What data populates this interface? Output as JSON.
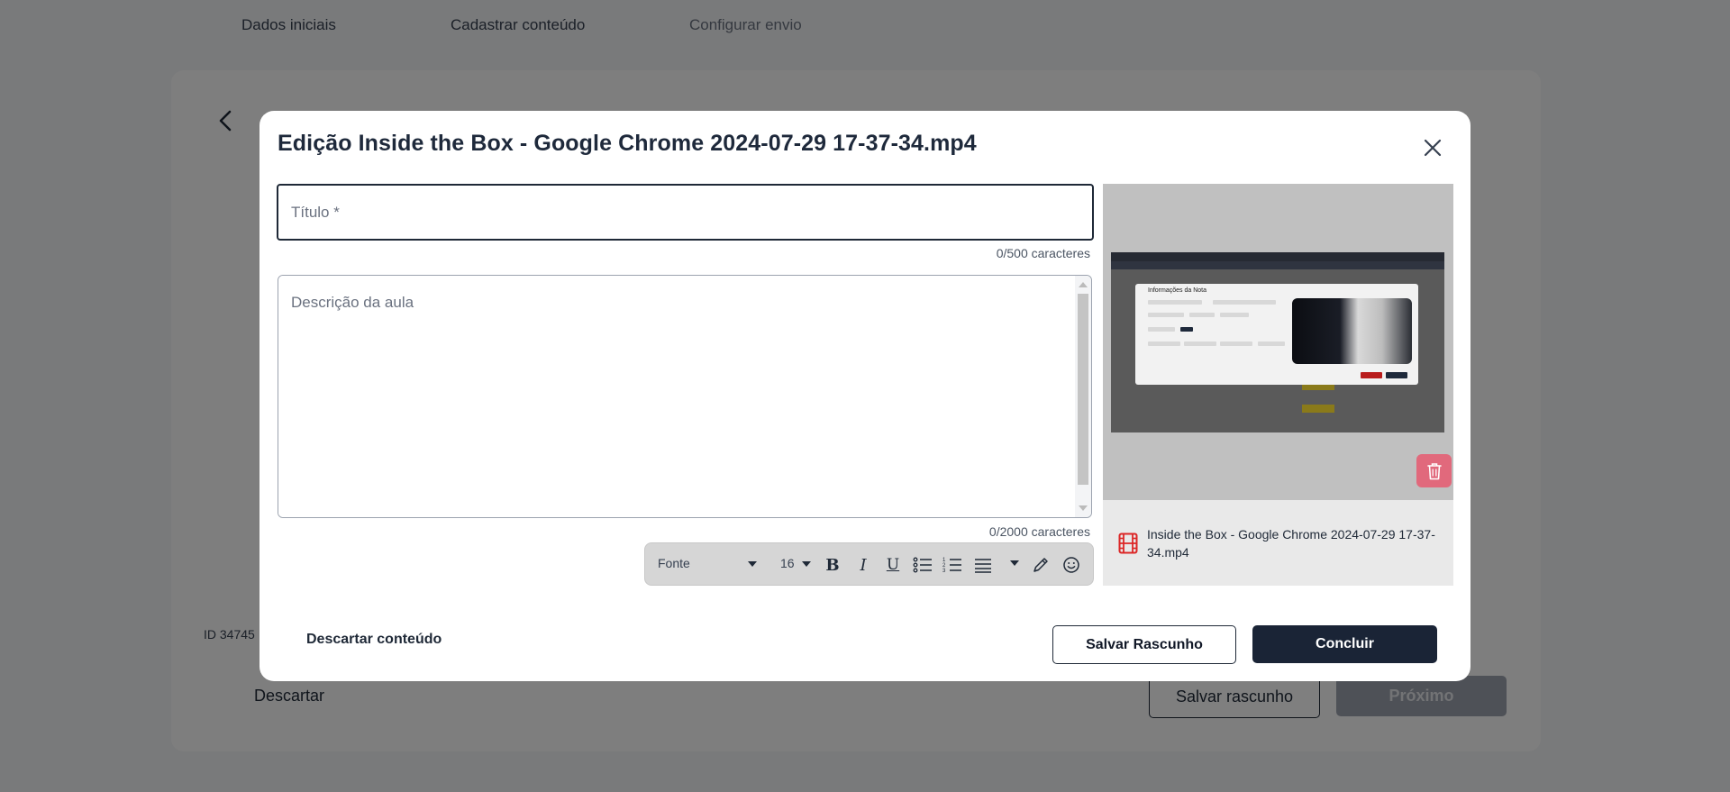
{
  "background": {
    "steps": [
      "Dados iniciais",
      "Cadastrar conteúdo",
      "Configurar envio"
    ],
    "id_text": "ID 34745 |",
    "discard_label": "Descartar",
    "save_label": "Salvar rascunho",
    "next_label": "Próximo"
  },
  "modal": {
    "title": "Edição Inside the Box - Google Chrome 2024-07-29 17-37-34.mp4",
    "title_field": {
      "placeholder": "Título *",
      "value": "",
      "counter": "0/500 caracteres"
    },
    "description_field": {
      "placeholder": "Descrição da aula",
      "value": "",
      "counter": "0/2000 caracteres"
    },
    "toolbar": {
      "font_label": "Fonte",
      "size_label": "16",
      "icons": [
        "bold-icon",
        "italic-icon",
        "underline-icon",
        "bullet-list-icon",
        "numbered-list-icon",
        "align-icon",
        "align-dropdown-icon",
        "pencil-icon",
        "emoji-icon"
      ]
    },
    "preview": {
      "file_name": "Inside the Box - Google Chrome 2024-07-29 17-37-34.mp4",
      "video_thumbnail_title": "Informações da Nota",
      "icons": [
        "trash-icon",
        "film-icon"
      ]
    },
    "actions": {
      "discard_label": "Descartar conteúdo",
      "save_draft_label": "Salvar Rascunho",
      "finish_label": "Concluir"
    }
  },
  "colors": {
    "primary": "#1a2436",
    "delete": "#e1697c",
    "file_icon": "#dc2626",
    "overlay": "rgba(0,0,0,0.5)"
  }
}
